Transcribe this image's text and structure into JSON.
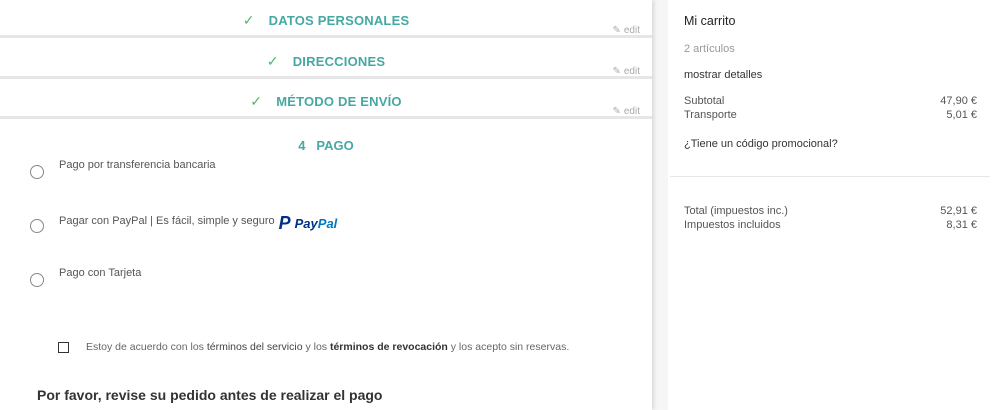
{
  "steps": [
    {
      "title": "DATOS PERSONALES",
      "edit": "edit"
    },
    {
      "title": "DIRECCIONES",
      "edit": "edit"
    },
    {
      "title": "MÉTODO DE ENVÍO",
      "edit": "edit"
    }
  ],
  "payment": {
    "number": "4",
    "title": "PAGO",
    "options": [
      {
        "label": "Pago por transferencia bancaria"
      },
      {
        "label": "Pagar con PayPal | Es fácil, simple y seguro",
        "logo_pay": "Pay",
        "logo_pal": "Pal"
      },
      {
        "label": "Pago con Tarjeta"
      }
    ],
    "terms": {
      "pre": "Estoy de acuerdo con los ",
      "link1": "términos del servicio",
      "mid": " y los ",
      "link2": "términos de revocación",
      "post": " y los acepto sin reservas."
    },
    "review": "Por favor, revise su pedido antes de realizar el pago"
  },
  "cart": {
    "title": "Mi carrito",
    "items": "2 artículos",
    "details": "mostrar detalles",
    "subtotal_label": "Subtotal",
    "subtotal": "47,90 €",
    "shipping_label": "Transporte",
    "shipping": "5,01 €",
    "promo": "¿Tiene un código promocional?",
    "total_label": "Total (impuestos inc.)",
    "total": "52,91 €",
    "tax_label": "Impuestos incluidos",
    "tax": "8,31 €"
  },
  "colors": {
    "accent": "#45a8a3",
    "check": "#4cbb6c"
  }
}
